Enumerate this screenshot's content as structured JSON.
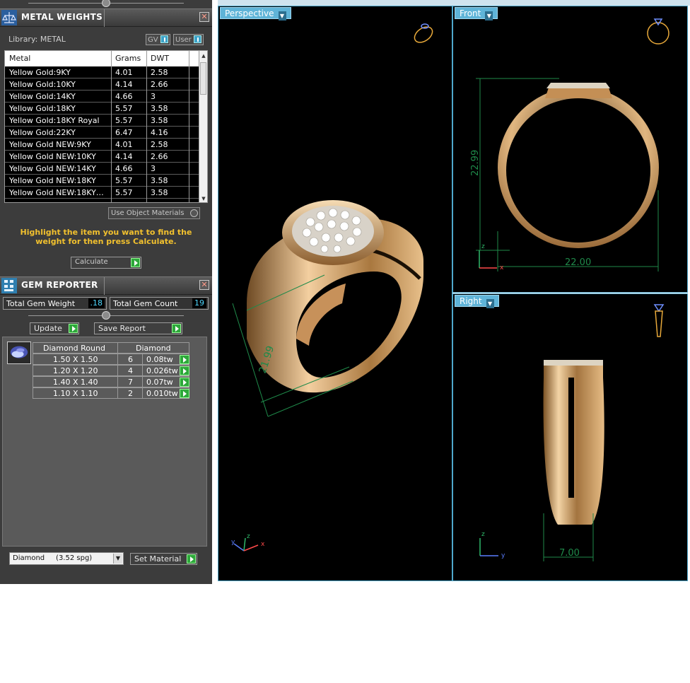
{
  "metal_weights": {
    "title": "METAL WEIGHTS",
    "library_label": "Library: METAL",
    "toggle_gv": "GV",
    "toggle_user": "User",
    "columns": [
      "Metal",
      "Grams",
      "DWT"
    ],
    "rows": [
      {
        "metal": "Yellow Gold:9KY",
        "grams": "4.01",
        "dwt": "2.58"
      },
      {
        "metal": "Yellow Gold:10KY",
        "grams": "4.14",
        "dwt": "2.66"
      },
      {
        "metal": "Yellow Gold:14KY",
        "grams": "4.66",
        "dwt": "3"
      },
      {
        "metal": "Yellow Gold:18KY",
        "grams": "5.57",
        "dwt": "3.58"
      },
      {
        "metal": "Yellow Gold:18KY Royal",
        "grams": "5.57",
        "dwt": "3.58"
      },
      {
        "metal": "Yellow Gold:22KY",
        "grams": "6.47",
        "dwt": "4.16"
      },
      {
        "metal": "Yellow Gold NEW:9KY",
        "grams": "4.01",
        "dwt": "2.58"
      },
      {
        "metal": "Yellow Gold NEW:10KY",
        "grams": "4.14",
        "dwt": "2.66"
      },
      {
        "metal": "Yellow Gold NEW:14KY",
        "grams": "4.66",
        "dwt": "3"
      },
      {
        "metal": "Yellow Gold NEW:18KY",
        "grams": "5.57",
        "dwt": "3.58"
      },
      {
        "metal": "Yellow Gold NEW:18KY…",
        "grams": "5.57",
        "dwt": "3.58"
      }
    ],
    "use_object_materials": "Use Object Materials",
    "hint": "Highlight the item you want to find the weight for then press Calculate.",
    "calculate": "Calculate"
  },
  "gem_reporter": {
    "title": "GEM REPORTER",
    "total_weight_label": "Total Gem Weight",
    "total_weight_value": ".18",
    "total_count_label": "Total Gem Count",
    "total_count_value": "19",
    "update": "Update",
    "save_report": "Save Report",
    "columns": [
      "Diamond Round",
      "Diamond"
    ],
    "rows": [
      {
        "size": "1.50 X 1.50",
        "count": "6",
        "weight": "0.08tw"
      },
      {
        "size": "1.20 X 1.20",
        "count": "4",
        "weight": "0.026tw"
      },
      {
        "size": "1.40 X 1.40",
        "count": "7",
        "weight": "0.07tw"
      },
      {
        "size": "1.10 X 1.10",
        "count": "2",
        "weight": "0.010tw"
      }
    ],
    "material_select": "Diamond     (3.52 spg)",
    "set_material": "Set Material"
  },
  "viewports": {
    "perspective": {
      "label": "Perspective",
      "dimension": "21.99"
    },
    "front": {
      "label": "Front",
      "height_dim": "22.99",
      "width_dim": "22.00"
    },
    "right": {
      "label": "Right",
      "width_dim": "7.00"
    }
  },
  "colors": {
    "accent": "#5fb4d8",
    "gold": "#c9975f",
    "dimension": "#1f8a4a"
  }
}
